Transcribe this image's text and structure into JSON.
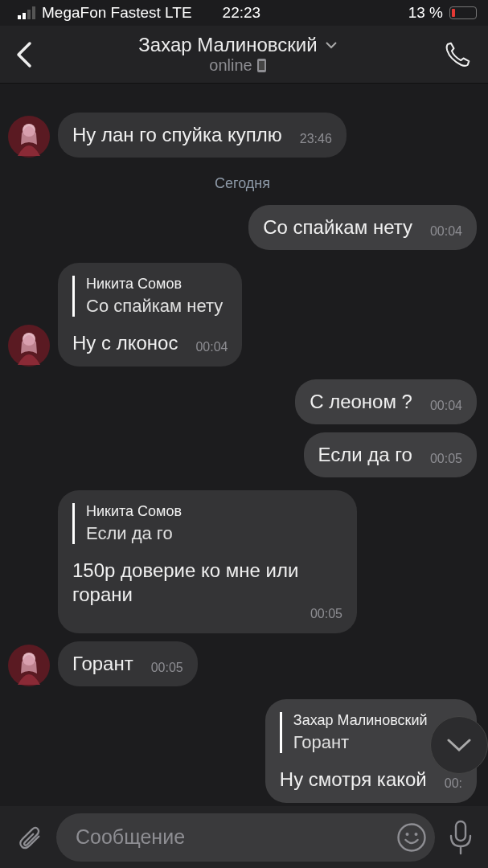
{
  "status_bar": {
    "carrier": "MegaFon Fastest LTE",
    "time": "22:23",
    "battery": "13 %"
  },
  "header": {
    "title": "Захар Малиновский",
    "status": "online"
  },
  "messages": [
    {
      "kind": "incoming",
      "avatar": true,
      "text": "Ну лан го спуйка куплю",
      "time": "23:46"
    },
    {
      "kind": "date",
      "text": "Сегодня"
    },
    {
      "kind": "outgoing",
      "text": "Со спайкам нету",
      "time": "00:04"
    },
    {
      "kind": "incoming",
      "avatar": true,
      "reply": {
        "author": "Никита Сомов",
        "text": "Со спайкам нету"
      },
      "text": "Ну с лконос",
      "time": "00:04"
    },
    {
      "kind": "outgoing",
      "text": "С леоном ?",
      "time": "00:04"
    },
    {
      "kind": "outgoing",
      "text": "Если да го",
      "time": "00:05"
    },
    {
      "kind": "incoming",
      "avatar": false,
      "reply": {
        "author": "Никита Сомов",
        "text": "Если да го"
      },
      "text": "150р доверие ко мне или горани",
      "time": "00:05"
    },
    {
      "kind": "incoming",
      "avatar": true,
      "text": "Горант",
      "time": "00:05"
    },
    {
      "kind": "outgoing",
      "reply": {
        "author": "Захар Малиновский",
        "text": "Горант"
      },
      "text": "Ну смотря какой",
      "time": "00:"
    }
  ],
  "composer": {
    "placeholder": "Сообщение"
  }
}
